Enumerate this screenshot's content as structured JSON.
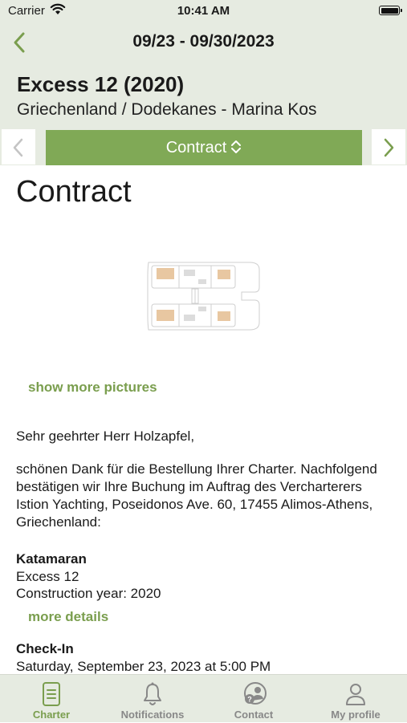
{
  "status_bar": {
    "carrier": "Carrier",
    "time": "10:41 AM"
  },
  "header": {
    "date_range": "09/23 - 09/30/2023",
    "boat_name": "Excess 12 (2020)",
    "location": "Griechenland / Dodekanes - Marina Kos"
  },
  "section_selector": {
    "label": "Contract"
  },
  "content": {
    "title": "Contract",
    "show_more_pictures": "show more pictures",
    "greeting": "Sehr geehrter Herr Holzapfel,",
    "intro": "schönen Dank für die Bestellung Ihrer Charter. Nachfolgend bestätigen wir Ihre Buchung im Auftrag des Vercharterers Istion Yachting, Poseidonos Ave. 60, 17455 Alimos-Athens, Griechenland:",
    "boat_section": {
      "heading": "Katamaran",
      "model": "Excess 12",
      "year": "Construction year: 2020"
    },
    "more_details": "more details",
    "checkin": {
      "heading": "Check-In",
      "datetime": "Saturday, September 23, 2023 at 5:00 PM"
    }
  },
  "bottom_nav": {
    "items": [
      {
        "label": "Charter",
        "icon": "document-icon",
        "active": true
      },
      {
        "label": "Notifications",
        "icon": "bell-icon",
        "active": false
      },
      {
        "label": "Contact",
        "icon": "support-icon",
        "active": false
      },
      {
        "label": "My profile",
        "icon": "person-icon",
        "active": false
      }
    ]
  },
  "colors": {
    "accent": "#80a956",
    "link": "#7a9e4e",
    "header_bg": "#e6ebe1"
  }
}
